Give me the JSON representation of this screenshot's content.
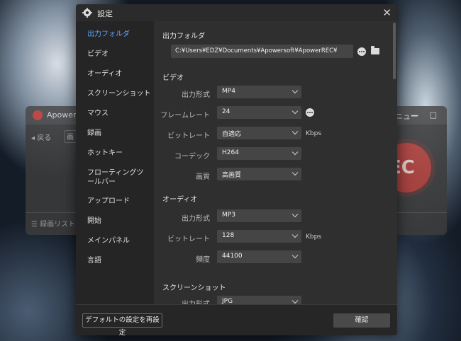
{
  "background_app": {
    "title": "ApowerR",
    "menu": "メニュー",
    "window_controls": "— □",
    "back": "◂ 戻る",
    "tab_stub": "画",
    "rec_label": "EC",
    "record_list": "☰ 録画リスト"
  },
  "dialog": {
    "title": "設定",
    "close": "✕"
  },
  "sidebar": {
    "items": [
      {
        "label": "出力フォルダ",
        "active": true
      },
      {
        "label": "ビデオ"
      },
      {
        "label": "オーディオ"
      },
      {
        "label": "スクリーンショット"
      },
      {
        "label": "マウス"
      },
      {
        "label": "録画"
      },
      {
        "label": "ホットキー"
      },
      {
        "label": "フローティングツールバー"
      },
      {
        "label": "アップロード"
      },
      {
        "label": "開始"
      },
      {
        "label": "メインパネル"
      },
      {
        "label": "言語"
      }
    ]
  },
  "output_folder": {
    "title": "出力フォルダ",
    "path": "C:¥Users¥EDZ¥Documents¥Apowersoft¥ApowerREC¥"
  },
  "video": {
    "title": "ビデオ",
    "format_label": "出力形式",
    "format_value": "MP4",
    "framerate_label": "フレームレート",
    "framerate_value": "24",
    "bitrate_label": "ビットレート",
    "bitrate_value": "自適応",
    "bitrate_unit": "Kbps",
    "codec_label": "コーデック",
    "codec_value": "H264",
    "quality_label": "画質",
    "quality_value": "高画質"
  },
  "audio": {
    "title": "オーディオ",
    "format_label": "出力形式",
    "format_value": "MP3",
    "bitrate_label": "ビットレート",
    "bitrate_value": "128",
    "bitrate_unit": "Kbps",
    "freq_label": "頻度",
    "freq_value": "44100"
  },
  "screenshot": {
    "title": "スクリーンショット",
    "format_label": "出力形式",
    "format_value": "JPG"
  },
  "footer": {
    "reset_label": "デフォルトの設定を再設定",
    "ok_label": "確認"
  },
  "colors": {
    "accent": "#5ba4ff",
    "dialog_bg": "#2b2b2b",
    "record_red": "#b5403a"
  }
}
